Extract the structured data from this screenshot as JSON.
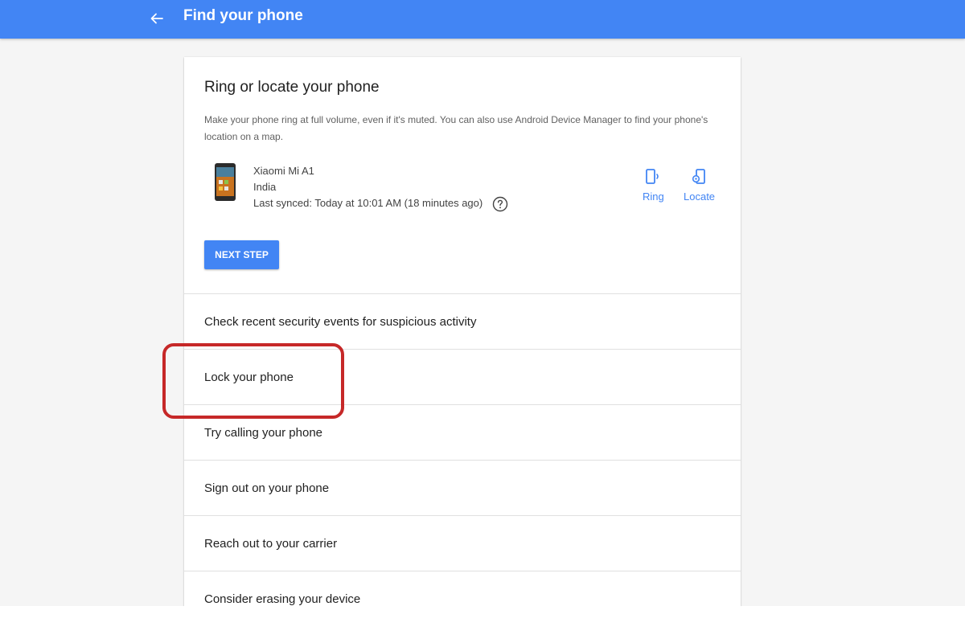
{
  "appbar": {
    "title": "Find your phone",
    "back_icon": "arrow-back-icon",
    "background": "#4285f4"
  },
  "ring_section": {
    "heading": "Ring or locate your phone",
    "description": "Make your phone ring at full volume, even if it's muted. You can also use Android Device Manager to find your phone's location on a map.",
    "device": {
      "name": "Xiaomi Mi A1",
      "country": "India",
      "last_synced": "Last synced: Today at 10:01 AM (18 minutes ago)",
      "help_icon": "help-circle-icon"
    },
    "actions": [
      {
        "label": "Ring",
        "icon": "ring-phone-icon"
      },
      {
        "label": "Locate",
        "icon": "locate-phone-icon"
      }
    ],
    "next_step_label": "NEXT STEP"
  },
  "options": [
    {
      "label": "Check recent security events for suspicious activity"
    },
    {
      "label": "Lock your phone"
    },
    {
      "label": "Try calling your phone"
    },
    {
      "label": "Sign out on your phone"
    },
    {
      "label": "Reach out to your carrier"
    },
    {
      "label": "Consider erasing your device"
    }
  ],
  "colors": {
    "accent": "#4285f4",
    "highlight": "#c62828"
  }
}
